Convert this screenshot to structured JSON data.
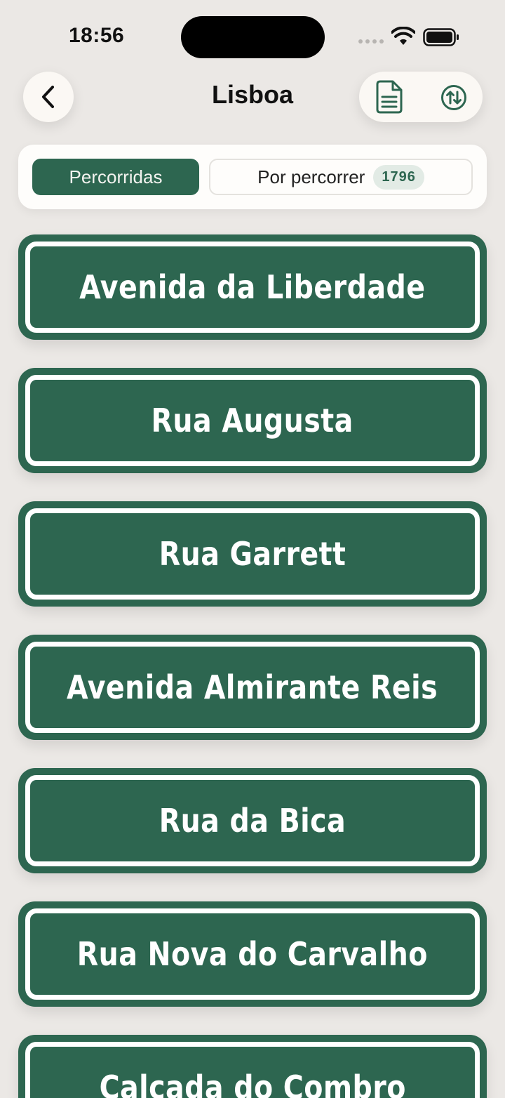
{
  "status_bar": {
    "time": "18:56"
  },
  "header": {
    "title": "Lisboa"
  },
  "segmented": {
    "active_label": "Percorridas",
    "inactive_label": "Por percorrer",
    "inactive_count": "1796"
  },
  "streets": [
    {
      "name": "Avenida da Liberdade"
    },
    {
      "name": "Rua Augusta"
    },
    {
      "name": "Rua Garrett"
    },
    {
      "name": "Avenida Almirante Reis"
    },
    {
      "name": "Rua da Bica"
    },
    {
      "name": "Rua Nova do Carvalho"
    },
    {
      "name": "Calcada do Combro"
    }
  ],
  "colors": {
    "background": "#ebe8e5",
    "accent_green": "#2d6650",
    "card": "#fbf8f4"
  }
}
